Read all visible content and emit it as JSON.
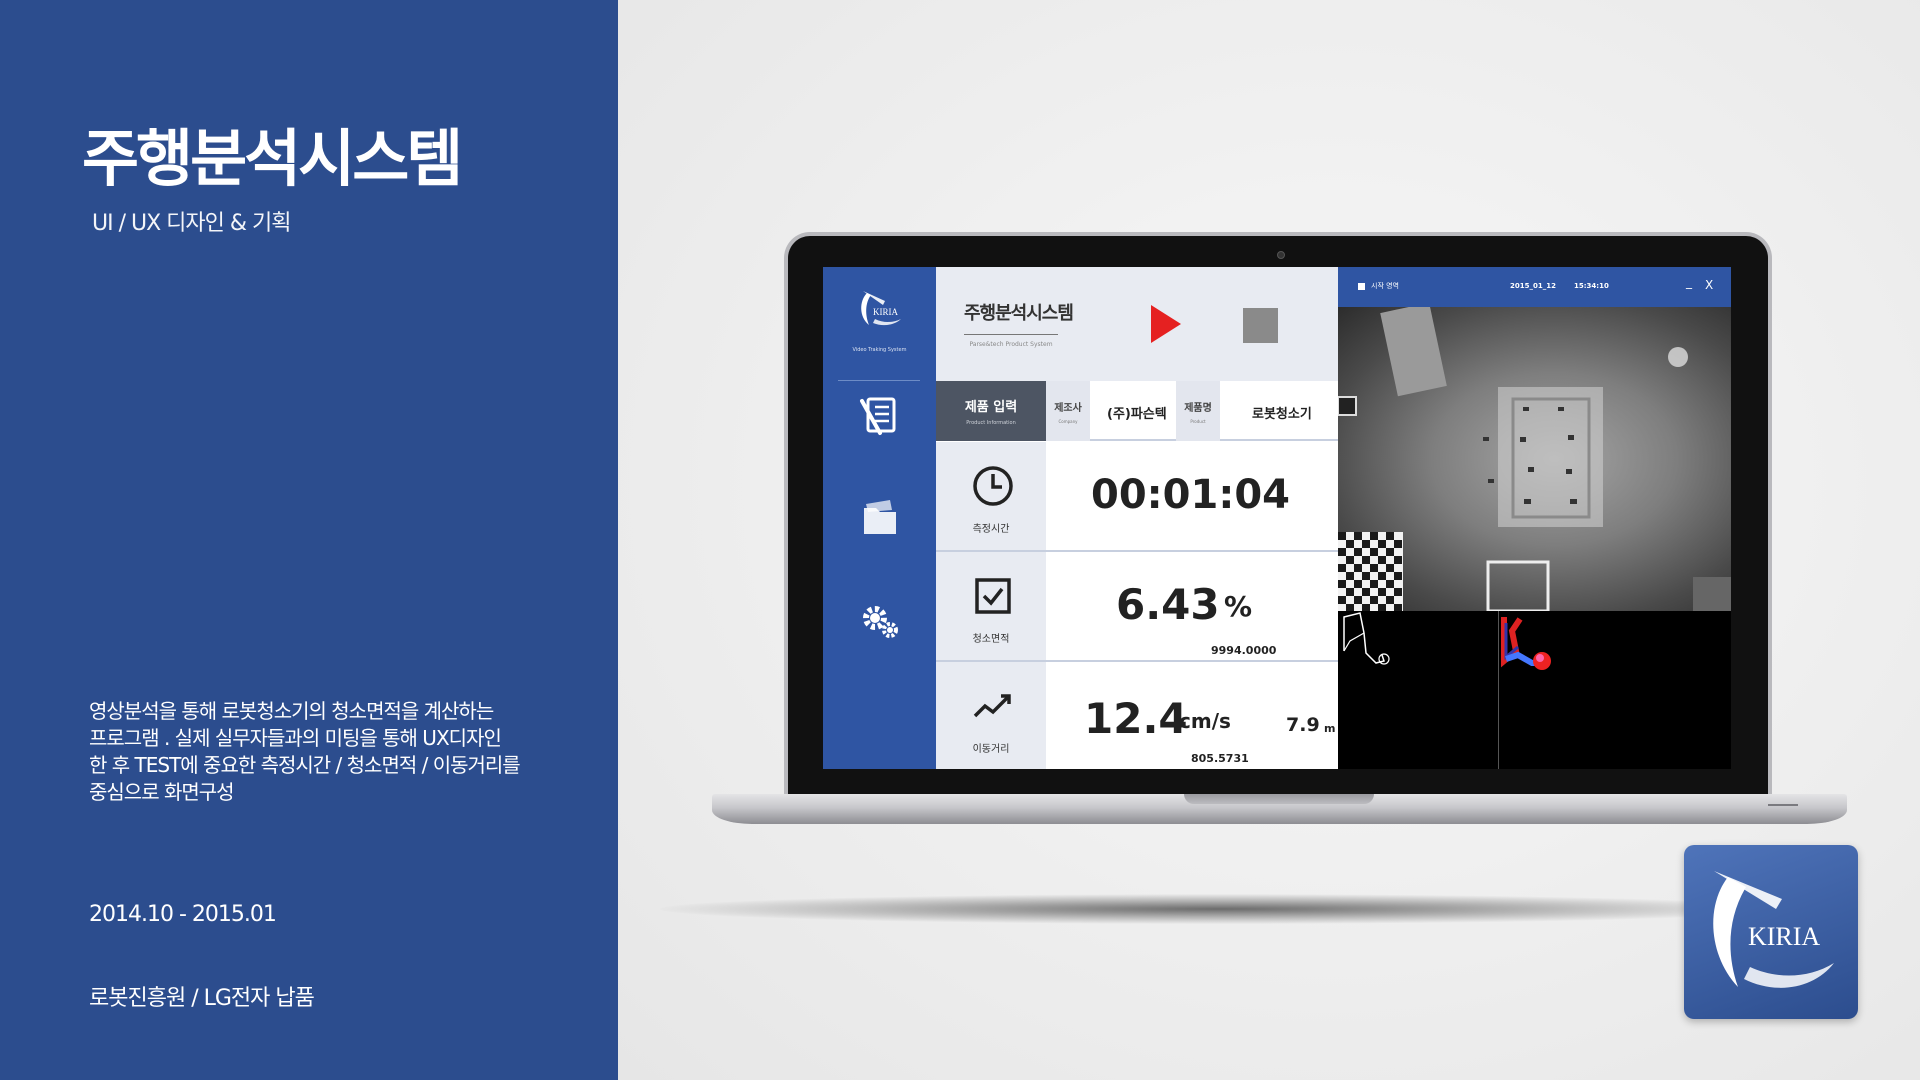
{
  "info": {
    "title": "주행분석시스템",
    "subtitle": "UI / UX 디자인 & 기획",
    "description_lines": [
      "영상분석을 통해 로봇청소기의 청소면적을 계산하는",
      "프로그램 . 실제 실무자들과의 미팅을 통해 UX디자인",
      "한 후 TEST에 중요한 측정시간 / 청소면적 / 이동거리를",
      "중심으로 화면구성"
    ],
    "period": "2014.10 - 2015.01",
    "client": "로봇진흥원 / LG전자 납품"
  },
  "app": {
    "logo_text": "KIRIA",
    "logo_subtitle": "Video Traking System",
    "title": "주행분석시스템",
    "title_sub": "Parse&tech Product System",
    "product": {
      "label": "제품 입력",
      "label_sub": "Product Information",
      "company_label": "제조사",
      "company_label_sub": "Company",
      "company_value": "(주)파슨텍",
      "product_label": "제품명",
      "product_label_sub": "Product",
      "product_value": "로봇청소기"
    },
    "metrics": {
      "time_label": "측정시간",
      "time_value": "00:01:04",
      "area_label": "청소면적",
      "area_value": "6.43",
      "area_unit": "%",
      "area_sub": "9994.0000",
      "move_label": "이동거리",
      "speed_value": "12.4",
      "speed_unit": "cm/s",
      "distance_value": "7.9",
      "distance_unit": "m",
      "move_sub": "805.5731"
    },
    "video": {
      "area_label": "시작 영역",
      "date": "2015_01_12",
      "time": "15:34:10",
      "minimize": "_",
      "close": "X"
    }
  },
  "badge": {
    "text": "KIRIA"
  },
  "colors": {
    "left_panel": "#2c4d8e",
    "sidebar": "#2f55a3",
    "play": "#e52121"
  }
}
